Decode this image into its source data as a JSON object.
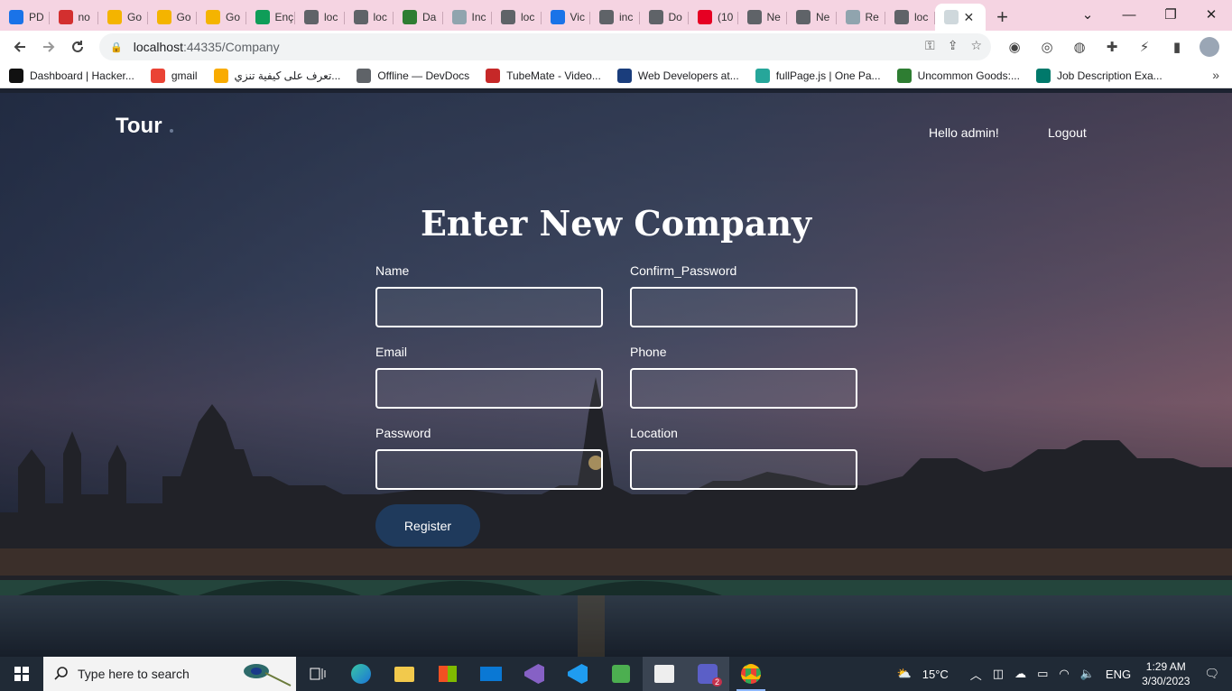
{
  "browser": {
    "tabs": [
      {
        "label": "PD",
        "color": "#1a73e8"
      },
      {
        "label": "no",
        "color": "#d32f2f"
      },
      {
        "label": "Go",
        "color": "#f4b400"
      },
      {
        "label": "Go",
        "color": "#f4b400"
      },
      {
        "label": "Go",
        "color": "#f4b400"
      },
      {
        "label": "Enç",
        "color": "#0f9d58"
      },
      {
        "label": "loc",
        "color": "#5f6368"
      },
      {
        "label": "loc",
        "color": "#5f6368"
      },
      {
        "label": "Da",
        "color": "#2e7d32"
      },
      {
        "label": "Inc",
        "color": "#90a4ae"
      },
      {
        "label": "loc",
        "color": "#5f6368"
      },
      {
        "label": "Vic",
        "color": "#1a73e8"
      },
      {
        "label": "inc",
        "color": "#5f6368"
      },
      {
        "label": "Do",
        "color": "#5f6368"
      },
      {
        "label": "(10",
        "color": "#e60023"
      },
      {
        "label": "Ne",
        "color": "#5f6368"
      },
      {
        "label": "Ne",
        "color": "#5f6368"
      },
      {
        "label": "Re",
        "color": "#90a4ae"
      },
      {
        "label": "loc",
        "color": "#5f6368"
      }
    ],
    "active_tab": {
      "label": "",
      "color": "#90a4ae",
      "close": "✕"
    },
    "new_tab": "+",
    "window_controls": {
      "dropdown": "⌄",
      "minimize": "—",
      "maximize": "❐",
      "close": "✕"
    },
    "url_host": "localhost",
    "url_rest": ":44335/Company",
    "bookmarks": [
      {
        "label": "Dashboard | Hacker...",
        "color": "#111111"
      },
      {
        "label": "gmail",
        "color": "#ea4335"
      },
      {
        "label": "تعرف على كيفية تنزي...",
        "color": "#f9ab00"
      },
      {
        "label": "Offline — DevDocs",
        "color": "#5f6368"
      },
      {
        "label": "TubeMate - Video...",
        "color": "#c62828"
      },
      {
        "label": "Web Developers at...",
        "color": "#1a3d7c"
      },
      {
        "label": "fullPage.js | One Pa...",
        "color": "#26a69a"
      },
      {
        "label": "Uncommon Goods:...",
        "color": "#2e7d32"
      },
      {
        "label": "Job Description Exa...",
        "color": "#00796b"
      }
    ],
    "bookmarks_more": "»"
  },
  "page": {
    "brand": "Tour",
    "nav": {
      "greeting": "Hello admin!",
      "logout": "Logout"
    },
    "form": {
      "title": "Enter New Company",
      "fields": {
        "name": {
          "label": "Name",
          "value": ""
        },
        "confirm_password": {
          "label": "Confirm_Password",
          "value": ""
        },
        "email": {
          "label": "Email",
          "value": ""
        },
        "phone": {
          "label": "Phone",
          "value": ""
        },
        "password": {
          "label": "Password",
          "value": ""
        },
        "location": {
          "label": "Location",
          "value": ""
        }
      },
      "submit_label": "Register"
    }
  },
  "taskbar": {
    "search_placeholder": "Type here to search",
    "weather_temp": "15°C",
    "language": "ENG",
    "time": "1:29 AM",
    "date": "3/30/2023",
    "teams_badge": "2"
  }
}
